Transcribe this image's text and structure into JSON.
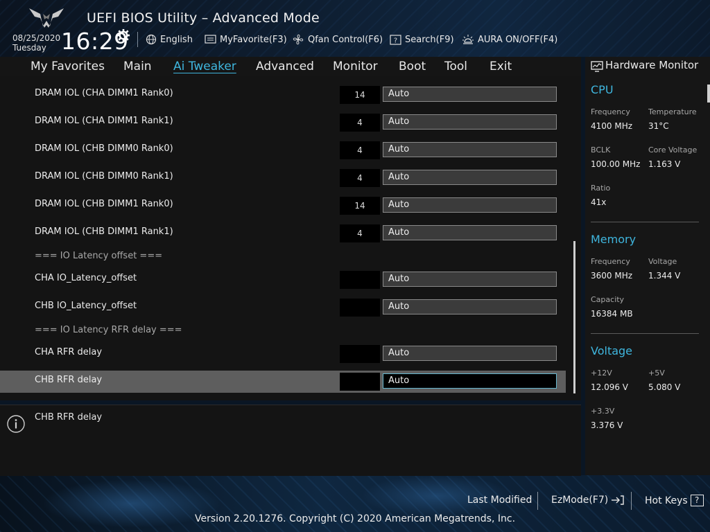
{
  "header": {
    "title": "UEFI BIOS Utility – Advanced Mode",
    "date": "08/25/2020",
    "day": "Tuesday",
    "time": "16:29",
    "toolbar": [
      {
        "label": "English",
        "icon": "globe-icon"
      },
      {
        "label": "MyFavorite(F3)",
        "icon": "favorite-list-icon"
      },
      {
        "label": "Qfan Control(F6)",
        "icon": "fan-icon"
      },
      {
        "label": "Search(F9)",
        "icon": "search-question-icon"
      },
      {
        "label": "AURA ON/OFF(F4)",
        "icon": "aura-light-icon"
      }
    ]
  },
  "menu": {
    "items": [
      "My Favorites",
      "Main",
      "Ai Tweaker",
      "Advanced",
      "Monitor",
      "Boot",
      "Tool",
      "Exit"
    ],
    "active": "Ai Tweaker"
  },
  "settings": [
    {
      "label": "DRAM IOL (CHA DIMM1 Rank0)",
      "current": "14",
      "value": "Auto"
    },
    {
      "label": "DRAM IOL (CHA DIMM1 Rank1)",
      "current": "4",
      "value": "Auto"
    },
    {
      "label": "DRAM IOL (CHB DIMM0 Rank0)",
      "current": "4",
      "value": "Auto"
    },
    {
      "label": "DRAM IOL (CHB DIMM0 Rank1)",
      "current": "4",
      "value": "Auto"
    },
    {
      "label": "DRAM IOL (CHB DIMM1 Rank0)",
      "current": "14",
      "value": "Auto"
    },
    {
      "label": "DRAM IOL (CHB DIMM1 Rank1)",
      "current": "4",
      "value": "Auto"
    },
    {
      "section": "=== IO Latency offset ==="
    },
    {
      "label": "CHA IO_Latency_offset",
      "current": "",
      "value": "Auto"
    },
    {
      "label": "CHB IO_Latency_offset",
      "current": "",
      "value": "Auto"
    },
    {
      "section": "=== IO Latency RFR delay ==="
    },
    {
      "label": "CHA RFR delay",
      "current": "",
      "value": "Auto"
    },
    {
      "label": "CHB RFR delay",
      "current": "",
      "value": "Auto",
      "selected": true
    }
  ],
  "help": {
    "text": "CHB RFR delay"
  },
  "hardware_monitor": {
    "title": "Hardware Monitor",
    "cpu": {
      "heading": "CPU",
      "frequency_label": "Frequency",
      "frequency": "4100 MHz",
      "temperature_label": "Temperature",
      "temperature": "31°C",
      "bclk_label": "BCLK",
      "bclk": "100.00 MHz",
      "core_voltage_label": "Core Voltage",
      "core_voltage": "1.163 V",
      "ratio_label": "Ratio",
      "ratio": "41x"
    },
    "memory": {
      "heading": "Memory",
      "frequency_label": "Frequency",
      "frequency": "3600 MHz",
      "voltage_label": "Voltage",
      "voltage": "1.344 V",
      "capacity_label": "Capacity",
      "capacity": "16384 MB"
    },
    "voltage": {
      "heading": "Voltage",
      "v12_label": "+12V",
      "v12": "12.096 V",
      "v5_label": "+5V",
      "v5": "5.080 V",
      "v33_label": "+3.3V",
      "v33": "3.376 V"
    }
  },
  "footer": {
    "last_modified": "Last Modified",
    "ezmode": "EzMode(F7)",
    "hot_keys": "Hot Keys",
    "hot_keys_key": "?",
    "version": "Version 2.20.1276. Copyright (C) 2020 American Megatrends, Inc."
  },
  "colors": {
    "accent": "#3fb6de",
    "selected_row": "#5e5e5e",
    "panel": "#141414"
  }
}
